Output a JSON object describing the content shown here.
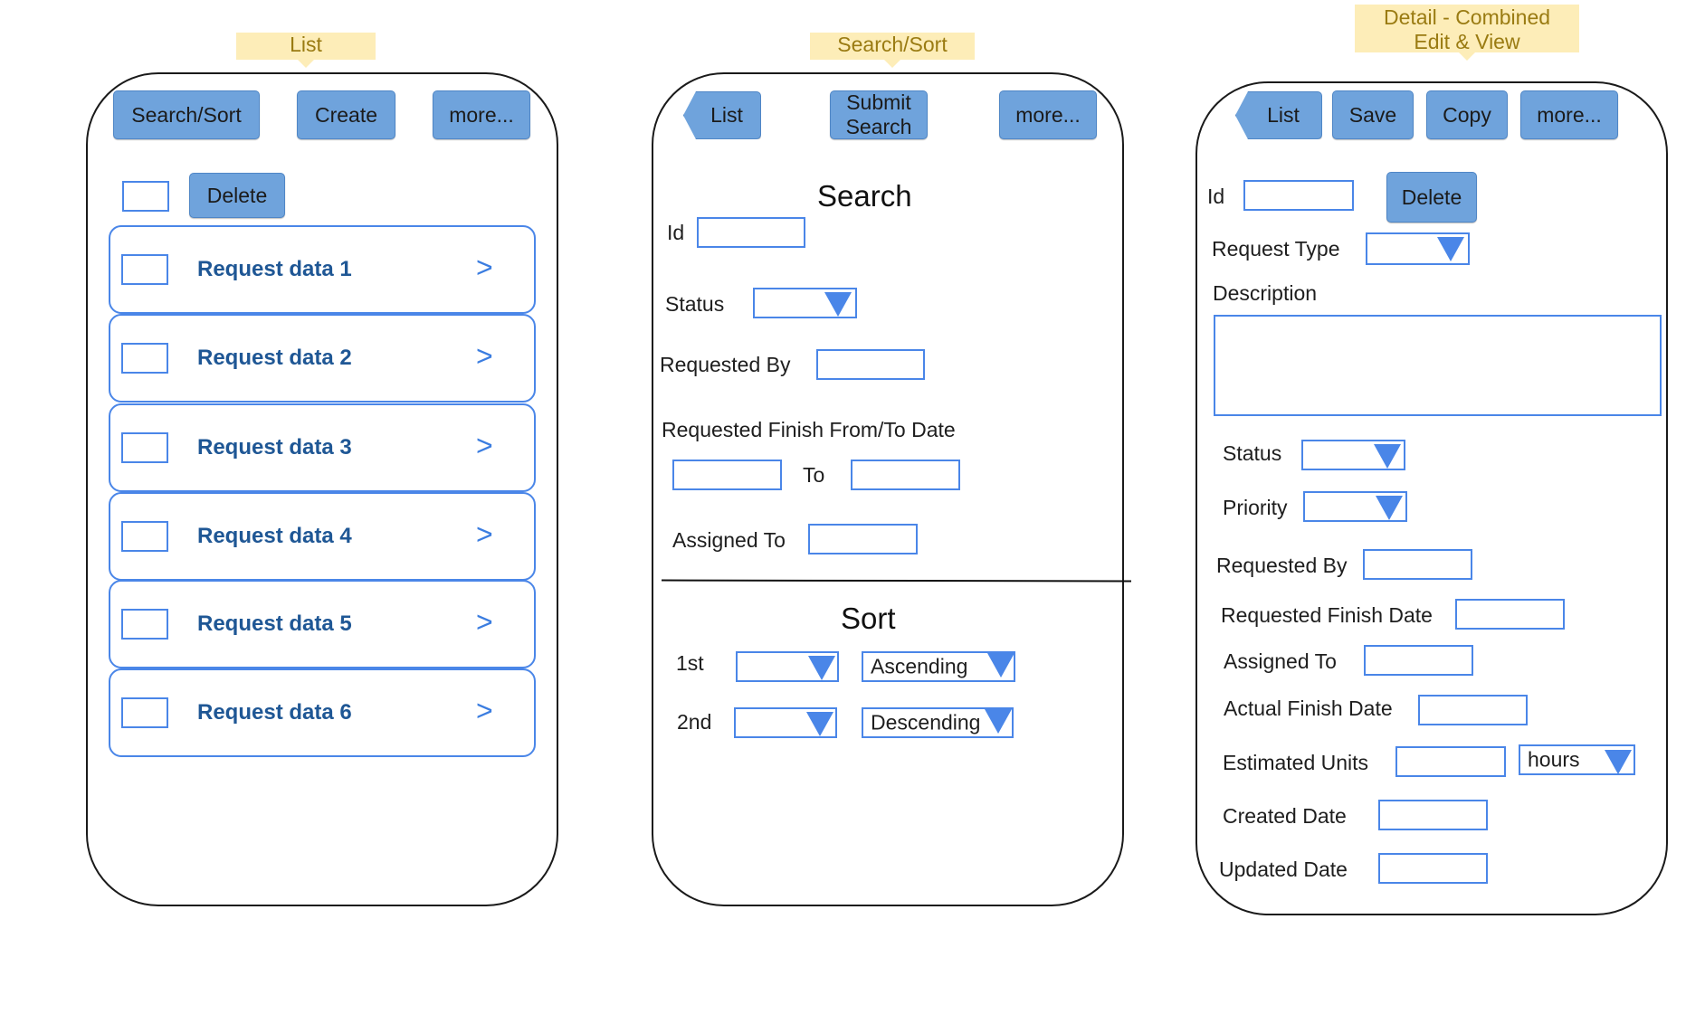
{
  "callouts": {
    "list": "List",
    "search": "Search/Sort",
    "detail_line1": "Detail - Combined",
    "detail_line2": "Edit & View"
  },
  "list_screen": {
    "buttons": {
      "search_sort": "Search/Sort",
      "create": "Create",
      "more": "more..."
    },
    "delete": "Delete",
    "rows": [
      {
        "label": "Request data 1",
        "chevron": ">"
      },
      {
        "label": "Request data 2",
        "chevron": ">"
      },
      {
        "label": "Request data 3",
        "chevron": ">"
      },
      {
        "label": "Request data 4",
        "chevron": ">"
      },
      {
        "label": "Request data 5",
        "chevron": ">"
      },
      {
        "label": "Request data 6",
        "chevron": ">"
      }
    ]
  },
  "search_screen": {
    "buttons": {
      "list": "List",
      "submit_line1": "Submit",
      "submit_line2": "Search",
      "more": "more..."
    },
    "search_heading": "Search",
    "labels": {
      "id": "Id",
      "status": "Status",
      "requested_by": "Requested By",
      "finish_range": "Requested Finish From/To Date",
      "to": "To",
      "assigned_to": "Assigned To"
    },
    "sort_heading": "Sort",
    "sort": {
      "first_label": "1st",
      "first_order": "Ascending",
      "second_label": "2nd",
      "second_order": "Descending"
    }
  },
  "detail_screen": {
    "buttons": {
      "list": "List",
      "save": "Save",
      "copy": "Copy",
      "more": "more...",
      "delete": "Delete"
    },
    "labels": {
      "id": "Id",
      "request_type": "Request Type",
      "description": "Description",
      "status": "Status",
      "priority": "Priority",
      "requested_by": "Requested By",
      "requested_finish_date": "Requested Finish Date",
      "assigned_to": "Assigned To",
      "actual_finish_date": "Actual Finish Date",
      "estimated_units": "Estimated Units",
      "created_date": "Created Date",
      "updated_date": "Updated Date"
    },
    "units_value": "hours"
  },
  "colors": {
    "button_fill": "#6fa3dc",
    "field_border": "#4a86e8",
    "callout_fill": "#fdedb8",
    "callout_text": "#9a7b12",
    "row_text": "#1f5795"
  }
}
